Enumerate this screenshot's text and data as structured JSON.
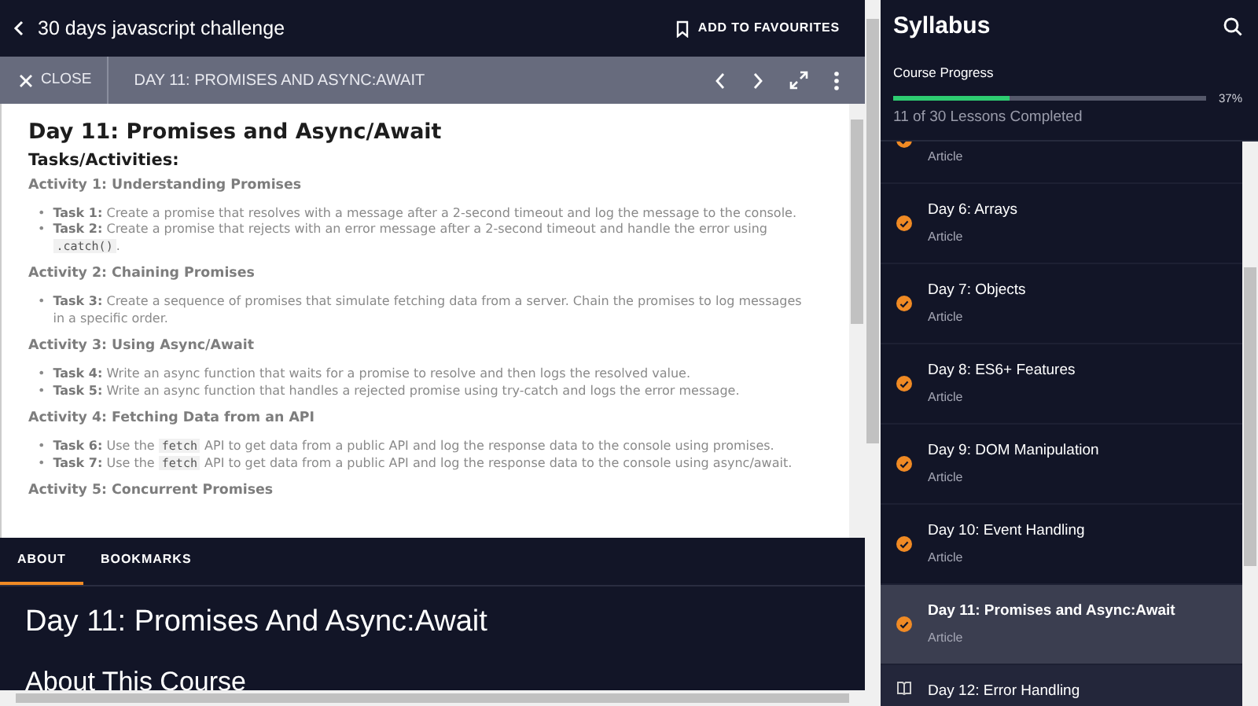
{
  "header": {
    "title": "30 days javascript challenge",
    "favourite_label": "ADD TO FAVOURITES"
  },
  "lesson_bar": {
    "close_label": "CLOSE",
    "title": "DAY 11: PROMISES AND ASYNC:AWAIT"
  },
  "article": {
    "title": "Day 11: Promises and Async/Await",
    "subtitle": "Tasks/Activities:",
    "bullet": "•",
    "sections": [
      {
        "heading": "Activity 1: Understanding Promises",
        "tasks": [
          {
            "label": "Task 1:",
            "parts": [
              {
                "kind": "text",
                "text": "Create a promise that resolves with a message after a 2-second timeout and log the message to the console."
              }
            ]
          },
          {
            "label": "Task 2:",
            "parts": [
              {
                "kind": "text",
                "text": "Create a promise that rejects with an error message after a 2-second timeout and handle the error using "
              },
              {
                "kind": "code",
                "text": ".catch()"
              },
              {
                "kind": "text",
                "text": "."
              }
            ]
          }
        ]
      },
      {
        "heading": "Activity 2: Chaining Promises",
        "tasks": [
          {
            "label": "Task 3:",
            "parts": [
              {
                "kind": "text",
                "text": "Create a sequence of promises that simulate fetching data from a server. Chain the promises to log messages in a specific order."
              }
            ]
          }
        ]
      },
      {
        "heading": "Activity 3: Using Async/Await",
        "tasks": [
          {
            "label": "Task 4:",
            "parts": [
              {
                "kind": "text",
                "text": "Write an async function that waits for a promise to resolve and then logs the resolved value."
              }
            ]
          },
          {
            "label": "Task 5:",
            "parts": [
              {
                "kind": "text",
                "text": "Write an async function that handles a rejected promise using try-catch and logs the error message."
              }
            ]
          }
        ]
      },
      {
        "heading": "Activity 4: Fetching Data from an API",
        "tasks": [
          {
            "label": "Task 6:",
            "parts": [
              {
                "kind": "text",
                "text": "Use the "
              },
              {
                "kind": "code",
                "text": "fetch"
              },
              {
                "kind": "text",
                "text": " API to get data from a public API and log the response data to the console using promises."
              }
            ]
          },
          {
            "label": "Task 7:",
            "parts": [
              {
                "kind": "text",
                "text": "Use the "
              },
              {
                "kind": "code",
                "text": "fetch"
              },
              {
                "kind": "text",
                "text": " API to get data from a public API and log the response data to the console using async/await."
              }
            ]
          }
        ]
      },
      {
        "heading": "Activity 5: Concurrent Promises"
      }
    ]
  },
  "tabs": [
    {
      "label": "ABOUT",
      "selected": true
    },
    {
      "label": "BOOKMARKS",
      "selected": false
    }
  ],
  "about": {
    "title": "Day 11: Promises And Async:Await",
    "heading": "About This Course"
  },
  "syllabus": {
    "title": "Syllabus",
    "progress_label": "Course Progress",
    "level": 0.37,
    "percent": "37%",
    "summary": "11 of 30 Lessons Completed",
    "lessons": [
      {
        "subtitle": "Article",
        "completed": true,
        "selected": false
      },
      {
        "title": "Day 6: Arrays",
        "subtitle": "Article",
        "completed": true,
        "selected": false
      },
      {
        "title": "Day 7: Objects",
        "subtitle": "Article",
        "completed": true,
        "selected": false
      },
      {
        "title": "Day 8: ES6+ Features",
        "subtitle": "Article",
        "completed": true,
        "selected": false
      },
      {
        "title": "Day 9: DOM Manipulation",
        "subtitle": "Article",
        "completed": true,
        "selected": false
      },
      {
        "title": "Day 10: Event Handling",
        "subtitle": "Article",
        "completed": true,
        "selected": false
      },
      {
        "title": "Day 11: Promises and Async:Await",
        "subtitle": "Article",
        "completed": true,
        "selected": true
      },
      {
        "title": "Day 12: Error Handling",
        "completed": false,
        "selected": false
      }
    ]
  }
}
